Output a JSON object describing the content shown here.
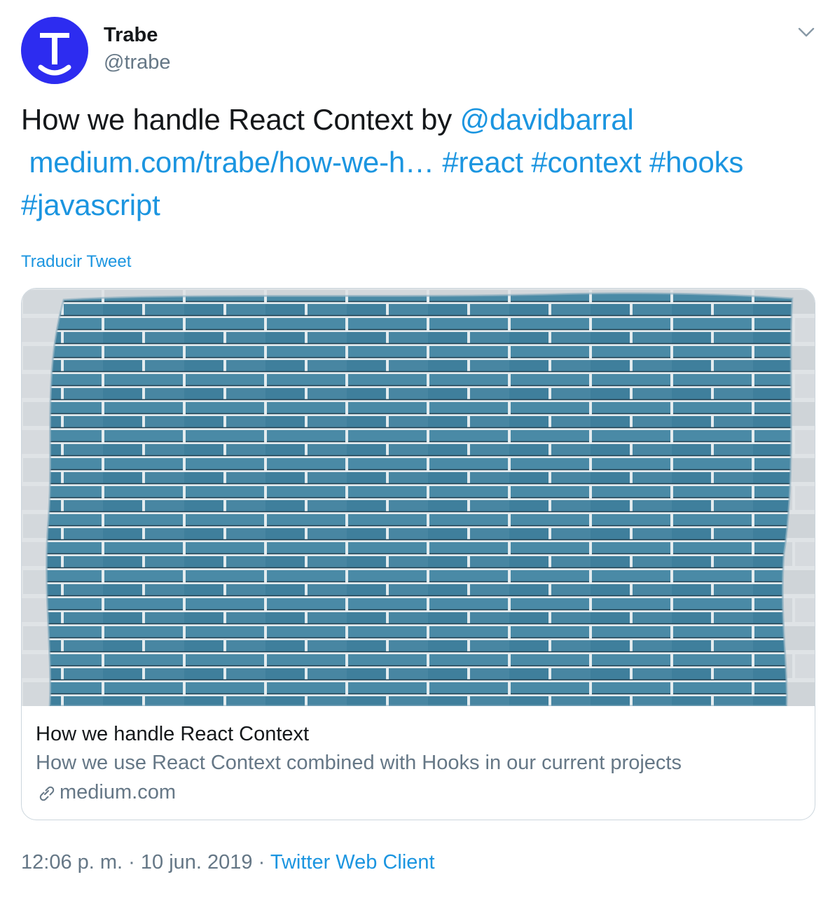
{
  "author": {
    "name": "Trabe",
    "handle": "@trabe",
    "avatar_letter": "T",
    "avatar_color": "#2d2cf0"
  },
  "menu": {
    "icon": "chevron-down-icon"
  },
  "tweet": {
    "text_prefix": "How we handle React Context by ",
    "mention": "@davidbarral",
    "link": "medium.com/trabe/how-we-h…",
    "hashtags": [
      "#react",
      "#context",
      "#hooks",
      "#javascript"
    ],
    "link_color": "#1b95e0"
  },
  "translate_label": "Traducir Tweet",
  "card": {
    "image_alt": "blue-painted-brick-wall",
    "title": "How we handle React Context",
    "description": "How we use React Context combined with Hooks in our current projects",
    "domain": "medium.com",
    "domain_icon": "link-icon"
  },
  "footer": {
    "time": "12:06 p. m.",
    "separator": "·",
    "date": "10 jun. 2019",
    "source": "Twitter Web Client"
  }
}
